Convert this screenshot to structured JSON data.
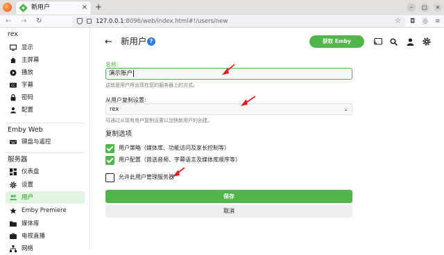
{
  "browser": {
    "tab_title": "新用户",
    "tab_close": "×",
    "new_tab": "+",
    "url_host": "127.0.0.1",
    "url_rest": ":8096/web/index.html#!/users/new",
    "min_label": "–",
    "max_label": "□",
    "close_label": "×"
  },
  "sidebar": {
    "user_header": "rex",
    "user_items": [
      {
        "label": "显示",
        "icon": "monitor-icon"
      },
      {
        "label": "主屏幕",
        "icon": "home-icon"
      },
      {
        "label": "播放",
        "icon": "play-icon"
      },
      {
        "label": "字幕",
        "icon": "subtitles-icon"
      },
      {
        "label": "密码",
        "icon": "key-icon"
      },
      {
        "label": "配置",
        "icon": "profile-icon"
      }
    ],
    "web_header": "Emby Web",
    "web_items": [
      {
        "label": "键盘与遥控",
        "icon": "keyboard-icon"
      }
    ],
    "server_header": "服务器",
    "server_items": [
      {
        "label": "仪表盘",
        "icon": "dashboard-icon"
      },
      {
        "label": "设置",
        "icon": "gear-icon"
      },
      {
        "label": "用户",
        "icon": "users-icon",
        "active": true
      },
      {
        "label": "Emby Premiere",
        "icon": "star-icon"
      },
      {
        "label": "媒体库",
        "icon": "folder-icon"
      },
      {
        "label": "电视直播",
        "icon": "tv-icon"
      },
      {
        "label": "网络",
        "icon": "network-icon"
      }
    ]
  },
  "header": {
    "title": "新用户",
    "help": "?",
    "premiere_button": "获取 Emby Premiere"
  },
  "form": {
    "name_label": "名称:",
    "name_value": "演示账户",
    "name_help": "这就是用户将出现在您的服务器上的方式。",
    "copy_label": "从用户复制设置:",
    "copy_value": "rex",
    "copy_help": "可通过从现有用户复制设置以加快新用户的创建。",
    "copy_options_title": "复制选项",
    "opt_policy": "用户策略（媒体库、功能访问及家长控制等）",
    "opt_policy_checked": true,
    "opt_config": "用户配置（首选音频、字幕语言及媒体库顺序等）",
    "opt_config_checked": true,
    "opt_admin": "允许此用户管理服务器",
    "opt_admin_checked": false,
    "save": "保存",
    "cancel": "取消"
  },
  "colors": {
    "accent": "#52b54b",
    "annotation": "#e02020"
  }
}
